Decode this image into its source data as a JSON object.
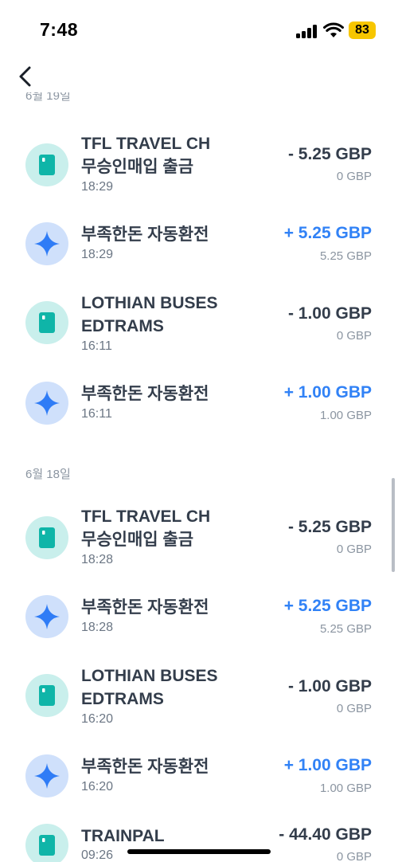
{
  "status_bar": {
    "time": "7:48",
    "battery": "83"
  },
  "sections": [
    {
      "date": "6월 19일",
      "items": [
        {
          "title1": "TFL TRAVEL CH",
          "title2": "무승인매입 출금",
          "time": "18:29",
          "amount": "- 5.25 GBP",
          "balance": "0 GBP",
          "kind": "card"
        },
        {
          "title1": "부족한돈 자동환전",
          "title2": "",
          "time": "18:29",
          "amount": "+ 5.25 GBP",
          "balance": "5.25 GBP",
          "kind": "exchange"
        },
        {
          "title1": "LOTHIAN BUSES",
          "title2": "EDTRAMS",
          "time": "16:11",
          "amount": "- 1.00 GBP",
          "balance": "0 GBP",
          "kind": "card"
        },
        {
          "title1": "부족한돈 자동환전",
          "title2": "",
          "time": "16:11",
          "amount": "+ 1.00 GBP",
          "balance": "1.00 GBP",
          "kind": "exchange"
        }
      ]
    },
    {
      "date": "6월 18일",
      "items": [
        {
          "title1": "TFL TRAVEL CH",
          "title2": "무승인매입 출금",
          "time": "18:28",
          "amount": "- 5.25 GBP",
          "balance": "0 GBP",
          "kind": "card"
        },
        {
          "title1": "부족한돈 자동환전",
          "title2": "",
          "time": "18:28",
          "amount": "+ 5.25 GBP",
          "balance": "5.25 GBP",
          "kind": "exchange"
        },
        {
          "title1": "LOTHIAN BUSES",
          "title2": "EDTRAMS",
          "time": "16:20",
          "amount": "- 1.00 GBP",
          "balance": "0 GBP",
          "kind": "card"
        },
        {
          "title1": "부족한돈 자동환전",
          "title2": "",
          "time": "16:20",
          "amount": "+ 1.00 GBP",
          "balance": "1.00 GBP",
          "kind": "exchange"
        },
        {
          "title1": "TRAINPAL",
          "title2": "",
          "time": "09:26",
          "amount": "- 44.40 GBP",
          "balance": "0 GBP",
          "kind": "card"
        }
      ]
    }
  ],
  "icons": {
    "back": "chevron-left-icon",
    "card": "card-icon",
    "exchange": "sparkle-icon"
  },
  "colors": {
    "plus_amount": "#3182f6",
    "card_bg": "#c9efec",
    "card_fg": "#0fb5a8",
    "exchange_bg": "#cfe0fb",
    "exchange_fg": "#2f7cf6"
  }
}
